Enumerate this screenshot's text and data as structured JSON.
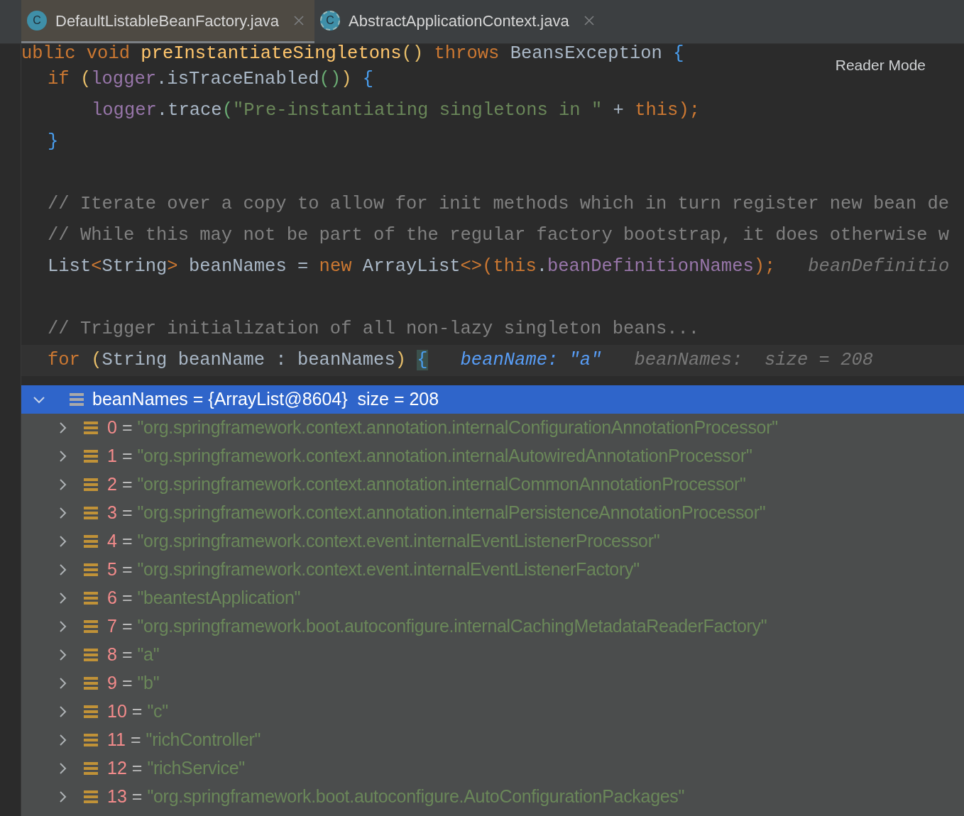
{
  "tabs": [
    {
      "label": "DefaultListableBeanFactory.java",
      "badge": "C",
      "kind": "class",
      "selected": true
    },
    {
      "label": "AbstractApplicationContext.java",
      "badge": "C",
      "kind": "abstract",
      "selected": false
    }
  ],
  "reader_mode": "Reader Mode",
  "code": [
    {
      "tokens": [
        {
          "text": "ublic void ",
          "kind": "keyword"
        },
        {
          "text": "preInstantiateSingletons",
          "kind": "method"
        },
        {
          "text": "() ",
          "kind": "paren"
        },
        {
          "text": "throws ",
          "kind": "keyword"
        },
        {
          "text": "BeansException ",
          "kind": "plain"
        },
        {
          "text": "{",
          "kind": "brace"
        }
      ],
      "children": [
        {
          "tokens": [
            {
              "text": "if ",
              "kind": "keyword"
            },
            {
              "text": "(",
              "kind": "paren"
            },
            {
              "text": "logger",
              "kind": "field"
            },
            {
              "text": ".isTraceEnabled",
              "kind": "plain"
            },
            {
              "text": "()",
              "kind": "paren2"
            },
            {
              "text": ") ",
              "kind": "paren"
            },
            {
              "text": "{",
              "kind": "brace"
            }
          ],
          "children": [
            {
              "tokens": [
                {
                  "text": "logger",
                  "kind": "field"
                },
                {
                  "text": ".trace",
                  "kind": "plain"
                },
                {
                  "text": "(",
                  "kind": "paren2"
                },
                {
                  "text": "\"Pre-instantiating singletons in \"",
                  "kind": "string"
                },
                {
                  "text": " + ",
                  "kind": "plain"
                },
                {
                  "text": "this",
                  "kind": "keyword"
                },
                {
                  "text": ");",
                  "kind": "keyword"
                }
              ]
            }
          ]
        },
        {
          "tokens": [
            {
              "text": "}",
              "kind": "brace"
            }
          ]
        },
        {
          "blank_before": true,
          "tokens": [
            {
              "text": "// Iterate over a copy to allow for init methods which in turn register new bean de",
              "kind": "comment"
            }
          ]
        },
        {
          "tokens": [
            {
              "text": "// While this may not be part of the regular factory bootstrap, it does otherwise w",
              "kind": "comment"
            }
          ]
        },
        {
          "tokens": [
            {
              "text": "List",
              "kind": "plain"
            },
            {
              "text": "<",
              "kind": "keyword"
            },
            {
              "text": "String",
              "kind": "plain"
            },
            {
              "text": "> ",
              "kind": "keyword"
            },
            {
              "text": "beanNames = ",
              "kind": "plain"
            },
            {
              "text": "new ",
              "kind": "keyword"
            },
            {
              "text": "ArrayList",
              "kind": "plain"
            },
            {
              "text": "<>(",
              "kind": "keyword"
            },
            {
              "text": "this",
              "kind": "keyword"
            },
            {
              "text": ".",
              "kind": "plain"
            },
            {
              "text": "beanDefinitionNames",
              "kind": "field"
            },
            {
              "text": ");",
              "kind": "keyword"
            },
            {
              "text": "   beanDefinitio",
              "kind": "hint"
            }
          ]
        },
        {
          "blank_before": true,
          "tokens": [
            {
              "text": "// Trigger initialization of all non-lazy singleton beans...",
              "kind": "comment"
            }
          ]
        },
        {
          "current": true,
          "tokens": [
            {
              "text": "for ",
              "kind": "keyword"
            },
            {
              "text": "(",
              "kind": "paren"
            },
            {
              "text": "String beanName : beanNames",
              "kind": "plain"
            },
            {
              "text": ") ",
              "kind": "paren"
            },
            {
              "text": "{",
              "kind": "brace_hl"
            },
            {
              "text": "   beanName: \"a\"",
              "kind": "hint_value"
            },
            {
              "text": "   beanNames:  size = 208",
              "kind": "hint"
            }
          ]
        }
      ]
    }
  ],
  "popup": {
    "header": {
      "label": "beanNames = {ArrayList@8604}  size = 208",
      "expanded": true,
      "selected": true
    },
    "rows": [
      {
        "index": "0",
        "sign": "=",
        "value": "\"org.springframework.context.annotation.internalConfigurationAnnotationProcessor\""
      },
      {
        "index": "1",
        "sign": "=",
        "value": "\"org.springframework.context.annotation.internalAutowiredAnnotationProcessor\""
      },
      {
        "index": "2",
        "sign": "=",
        "value": "\"org.springframework.context.annotation.internalCommonAnnotationProcessor\""
      },
      {
        "index": "3",
        "sign": "=",
        "value": "\"org.springframework.context.annotation.internalPersistenceAnnotationProcessor\""
      },
      {
        "index": "4",
        "sign": "=",
        "value": "\"org.springframework.context.event.internalEventListenerProcessor\""
      },
      {
        "index": "5",
        "sign": "=",
        "value": "\"org.springframework.context.event.internalEventListenerFactory\""
      },
      {
        "index": "6",
        "sign": "=",
        "value": "\"beantestApplication\""
      },
      {
        "index": "7",
        "sign": "=",
        "value": "\"org.springframework.boot.autoconfigure.internalCachingMetadataReaderFactory\""
      },
      {
        "index": "8",
        "sign": "=",
        "value": "\"a\""
      },
      {
        "index": "9",
        "sign": "=",
        "value": "\"b\""
      },
      {
        "index": "10",
        "sign": "=",
        "value": "\"c\""
      },
      {
        "index": "11",
        "sign": "=",
        "value": "\"richController\""
      },
      {
        "index": "12",
        "sign": "=",
        "value": "\"richService\""
      },
      {
        "index": "13",
        "sign": "=",
        "value": "\"org.springframework.boot.autoconfigure.AutoConfigurationPackages\""
      }
    ]
  }
}
